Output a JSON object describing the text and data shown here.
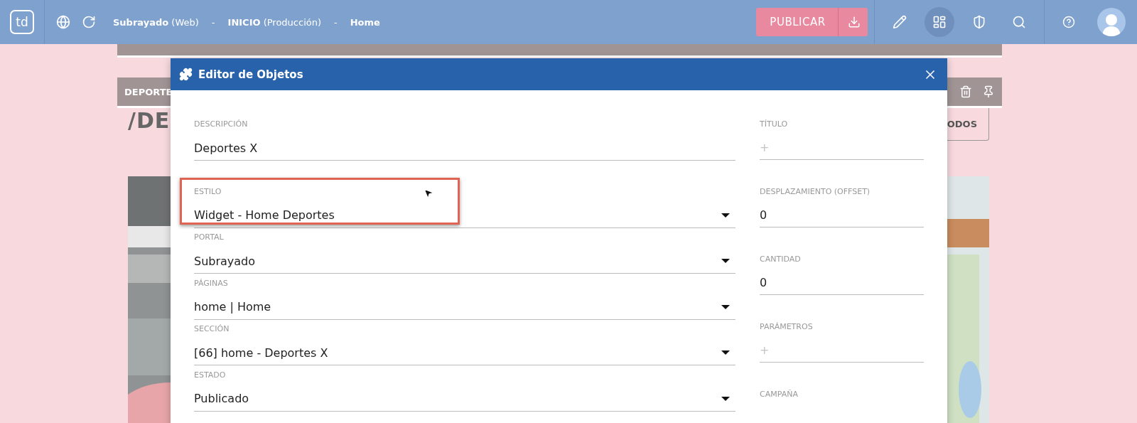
{
  "header": {
    "logo": "td",
    "breadcrumb": [
      {
        "name": "Subrayado",
        "detail": "(Web)"
      },
      {
        "separator": "-",
        "name": "INICIO",
        "detail": "(Producción)"
      },
      {
        "separator": "-",
        "name": "Home"
      }
    ],
    "publish_button": "PUBLICAR",
    "tools": [
      {
        "kind": "edit",
        "selected": false
      },
      {
        "kind": "layout",
        "selected": true
      },
      {
        "kind": "shield",
        "selected": false
      },
      {
        "kind": "search",
        "selected": false
      }
    ]
  },
  "background": {
    "section_title": "DEPORTE",
    "heading": "/DE",
    "button": "ODOS"
  },
  "modal": {
    "title": "Editor de Objetos",
    "left_fields": [
      {
        "kind": "text",
        "label": "DESCRIPCIÓN",
        "value": "Deportes X",
        "highlighted": false
      },
      {
        "kind": "select",
        "label": "ESTILO",
        "value": "Widget - Home Deportes",
        "highlighted": true
      },
      {
        "kind": "select",
        "label": "PORTAL",
        "value": "Subrayado",
        "highlighted": false
      },
      {
        "kind": "select",
        "label": "PÁGINAS",
        "value": "home | Home",
        "highlighted": false
      },
      {
        "kind": "select",
        "label": "SECCIÓN",
        "value": "[66] home - Deportes X",
        "highlighted": false
      },
      {
        "kind": "select",
        "label": "ESTADO",
        "value": "Publicado",
        "highlighted": false
      }
    ],
    "right_fields": [
      {
        "label": "TÍTULO",
        "placeholder": "+"
      },
      {
        "label": "DESPLAZAMIENTO (OFFSET)",
        "value": "0"
      },
      {
        "label": "CANTIDAD",
        "value": "0"
      },
      {
        "label": "PARÁMETROS",
        "placeholder": "+"
      },
      {
        "label": "CAMPAÑA"
      }
    ]
  }
}
